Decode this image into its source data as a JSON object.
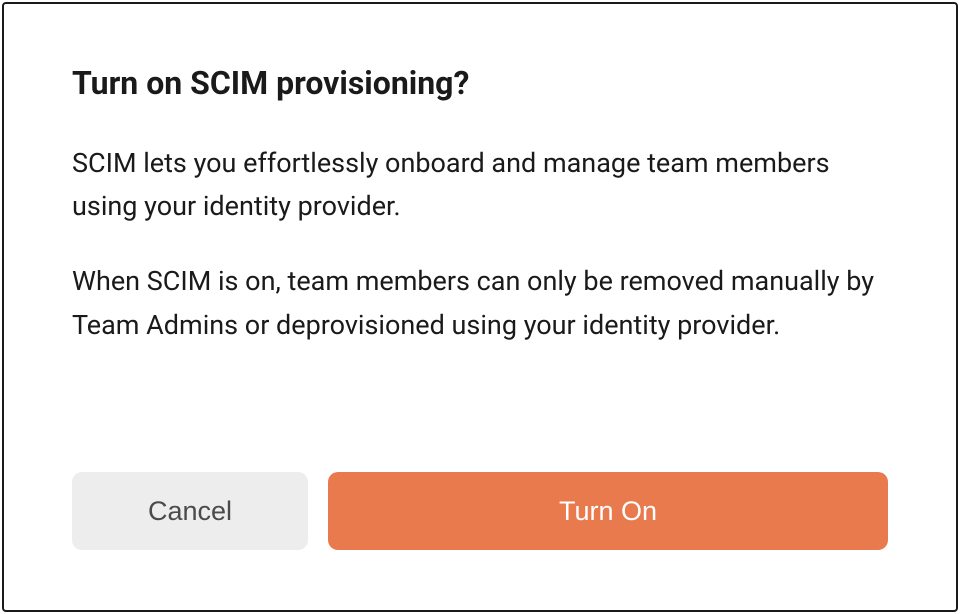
{
  "dialog": {
    "title": "Turn on SCIM provisioning?",
    "paragraph1": "SCIM lets you effortlessly onboard and manage team members using your identity provider.",
    "paragraph2": "When SCIM is on, team members can only be removed manually by Team Admins or deprovisioned using your identity provider.",
    "cancel_label": "Cancel",
    "confirm_label": "Turn On"
  }
}
